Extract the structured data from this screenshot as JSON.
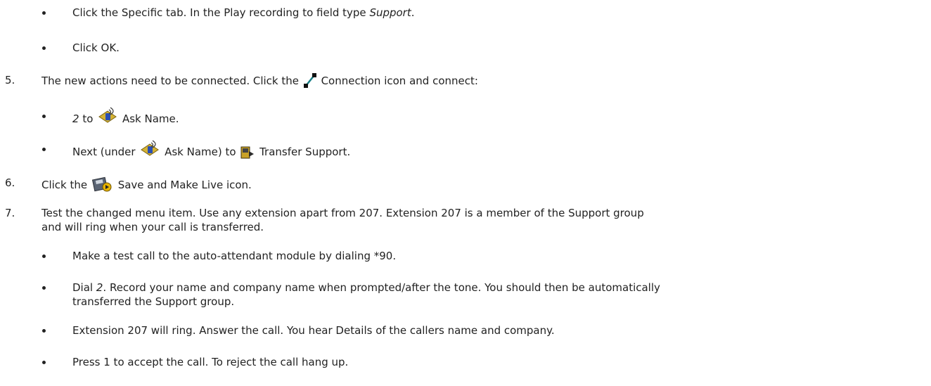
{
  "instructions": {
    "s4": {
      "b1": {
        "pre": "Click the Specific tab. In the Play recording to field type ",
        "term": "Support",
        "post": "."
      },
      "b2": "Click OK."
    },
    "s5": {
      "num": "5.",
      "text_pre": "The new actions need to be connected. Click the",
      "icon_label": "Connection",
      "text_post": "icon and connect:",
      "b1": {
        "key": "2",
        "mid": "to",
        "target": "Ask Name."
      },
      "b2": {
        "pre": "Next (under",
        "ref": "Ask Name) to",
        "target": "Transfer Support."
      }
    },
    "s6": {
      "num": "6.",
      "pre": "Click the",
      "post": "Save and Make Live icon."
    },
    "s7": {
      "num": "7.",
      "line1": "Test the changed menu item. Use any extension apart from 207. Extension 207 is a member of the Support group",
      "line2": "and will ring when your call is transferred.",
      "b1": "Make a test call to the auto-attendant module by dialing *90.",
      "b2": {
        "pre": "Dial ",
        "key": "2",
        "line1_post": ". Record your name and company name when prompted/after the tone. You should then be automatically",
        "line2": "transferred the Support group."
      },
      "b3": "Extension 207 will ring. Answer the call. You hear Details of the callers name and company.",
      "b4": "Press 1 to accept the call. To reject the call hang up."
    }
  },
  "icons": {
    "connection": "connection-line-icon",
    "ask_name": "ask-name-recording-icon",
    "transfer": "transfer-icon",
    "save_live": "save-and-make-live-icon"
  },
  "colors": {
    "text": "#222222",
    "connection_icon": "#1a7f86"
  }
}
